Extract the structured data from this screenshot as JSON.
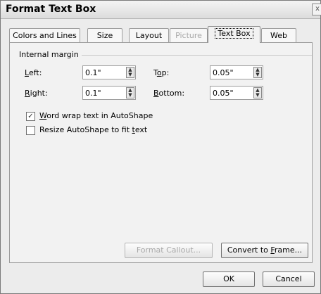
{
  "dialog": {
    "title": "Format Text Box",
    "close_glyph": "x"
  },
  "tabs": [
    {
      "label": "Colors and Lines",
      "state": "normal"
    },
    {
      "label": "Size",
      "state": "normal"
    },
    {
      "label": "Layout",
      "state": "normal"
    },
    {
      "label": "Picture",
      "state": "disabled"
    },
    {
      "label": "Text Box",
      "state": "active"
    },
    {
      "label": "Web",
      "state": "normal"
    }
  ],
  "internal_margin": {
    "section_label": "Internal margin",
    "left": {
      "label_u": "L",
      "label_rest": "eft:",
      "value": "0.1\""
    },
    "right": {
      "label_u": "R",
      "label_rest": "ight:",
      "value": "0.1\""
    },
    "top": {
      "label_pre": "T",
      "label_u": "o",
      "label_rest": "p:",
      "value": "0.05\""
    },
    "bottom": {
      "label_u": "B",
      "label_rest": "ottom:",
      "value": "0.05\""
    }
  },
  "options": {
    "word_wrap": {
      "label_u": "W",
      "label_rest": "ord wrap text in AutoShape",
      "checked": true,
      "check_glyph": "✓"
    },
    "resize": {
      "label_pre": "Resize AutoShape to fit ",
      "label_u": "t",
      "label_rest": "ext",
      "checked": false
    }
  },
  "buttons": {
    "format_callout": "Format Callout...",
    "convert_pre": "Convert to ",
    "convert_u": "F",
    "convert_rest": "rame...",
    "ok": "OK",
    "cancel": "Cancel"
  },
  "icons": {
    "spin_up": "▲",
    "spin_down": "▼"
  }
}
